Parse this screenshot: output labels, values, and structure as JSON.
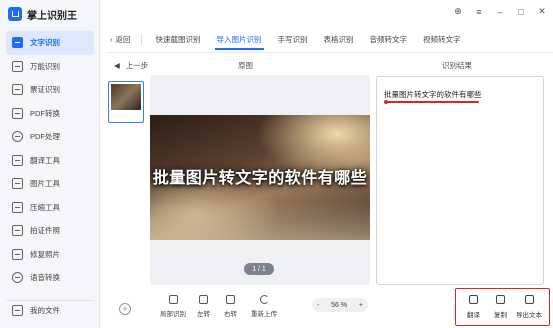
{
  "app": {
    "title": "掌上识别王"
  },
  "window_controls": {
    "skin": "⊕",
    "menu": "≡",
    "minimize": "–",
    "maximize": "□",
    "close": "✕"
  },
  "sidebar": {
    "items": [
      {
        "label": "文字识别",
        "icon": "text-recognition-icon",
        "active": true
      },
      {
        "label": "万能识别",
        "icon": "universal-recognition-icon"
      },
      {
        "label": "票证识别",
        "icon": "ticket-recognition-icon"
      },
      {
        "label": "PDF转换",
        "icon": "pdf-convert-icon"
      },
      {
        "label": "PDF处理",
        "icon": "pdf-process-icon"
      },
      {
        "label": "翻译工具",
        "icon": "translate-icon"
      },
      {
        "label": "图片工具",
        "icon": "image-tool-icon"
      },
      {
        "label": "压缩工具",
        "icon": "compress-icon"
      },
      {
        "label": "拍证件照",
        "icon": "id-photo-icon"
      },
      {
        "label": "修复照片",
        "icon": "repair-photo-icon"
      },
      {
        "label": "语音转换",
        "icon": "voice-convert-icon"
      }
    ],
    "footer_label": "我的文件"
  },
  "topbar": {
    "back_label": "返回",
    "tabs": [
      {
        "label": "快速截图识别"
      },
      {
        "label": "导入图片识别",
        "active": true
      },
      {
        "label": "手写识别"
      },
      {
        "label": "表格识别"
      },
      {
        "label": "音频转文字"
      },
      {
        "label": "视频转文字"
      }
    ]
  },
  "pager": {
    "label": "上一步"
  },
  "columns": {
    "original": "原图",
    "result": "识别结果"
  },
  "preview": {
    "banner_text": "批量图片转文字的软件有哪些",
    "page_indicator": "1 / 1"
  },
  "result": {
    "text": "批量图片转文字的软件有哪些"
  },
  "toolbar": {
    "add": "+",
    "crop": "局部识别",
    "rotate_left": "左转",
    "rotate_right": "右转",
    "reupload": "重新上传",
    "zoom_out": "-",
    "zoom_value": "56 %",
    "zoom_in": "+",
    "translate": "翻译",
    "copy": "复制",
    "export": "导出文本"
  },
  "colors": {
    "accent": "#1f6bff",
    "highlight": "#e02424"
  }
}
